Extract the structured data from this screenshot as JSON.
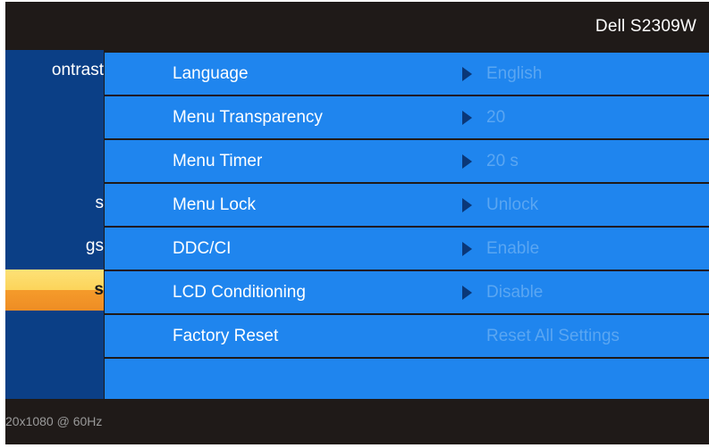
{
  "header": {
    "model": "Dell S2309W"
  },
  "nav": {
    "items": [
      {
        "label": "ontrast",
        "selected": false
      },
      {
        "label": "",
        "selected": false
      },
      {
        "label": "",
        "selected": false
      },
      {
        "label": "s",
        "selected": false
      },
      {
        "label": "gs",
        "selected": false
      },
      {
        "label": "s",
        "selected": true
      },
      {
        "label": "",
        "selected": false
      }
    ]
  },
  "submenu": {
    "rows": [
      {
        "label": "Language",
        "value": "English",
        "has_arrow": true
      },
      {
        "label": "Menu Transparency",
        "value": "20",
        "has_arrow": true
      },
      {
        "label": "Menu Timer",
        "value": "20 s",
        "has_arrow": true
      },
      {
        "label": "Menu Lock",
        "value": "Unlock",
        "has_arrow": true
      },
      {
        "label": "DDC/CI",
        "value": "Enable",
        "has_arrow": true
      },
      {
        "label": "LCD Conditioning",
        "value": "Disable",
        "has_arrow": true
      },
      {
        "label": "Factory Reset",
        "value": "Reset All Settings",
        "has_arrow": false
      },
      {
        "label": "",
        "value": "",
        "has_arrow": false
      }
    ]
  },
  "footer": {
    "resolution": "20x1080 @ 60Hz"
  },
  "colors": {
    "osd_background": "#1f1a18",
    "nav_background": "#0b3f86",
    "row_background": "#1f85ee",
    "value_text": "#5aa6f2",
    "arrow": "#0a3778",
    "selected_top": "#fcd45a",
    "selected_bottom": "#f59b2b"
  },
  "icons": {
    "row_arrow": "triangle-right-icon"
  }
}
